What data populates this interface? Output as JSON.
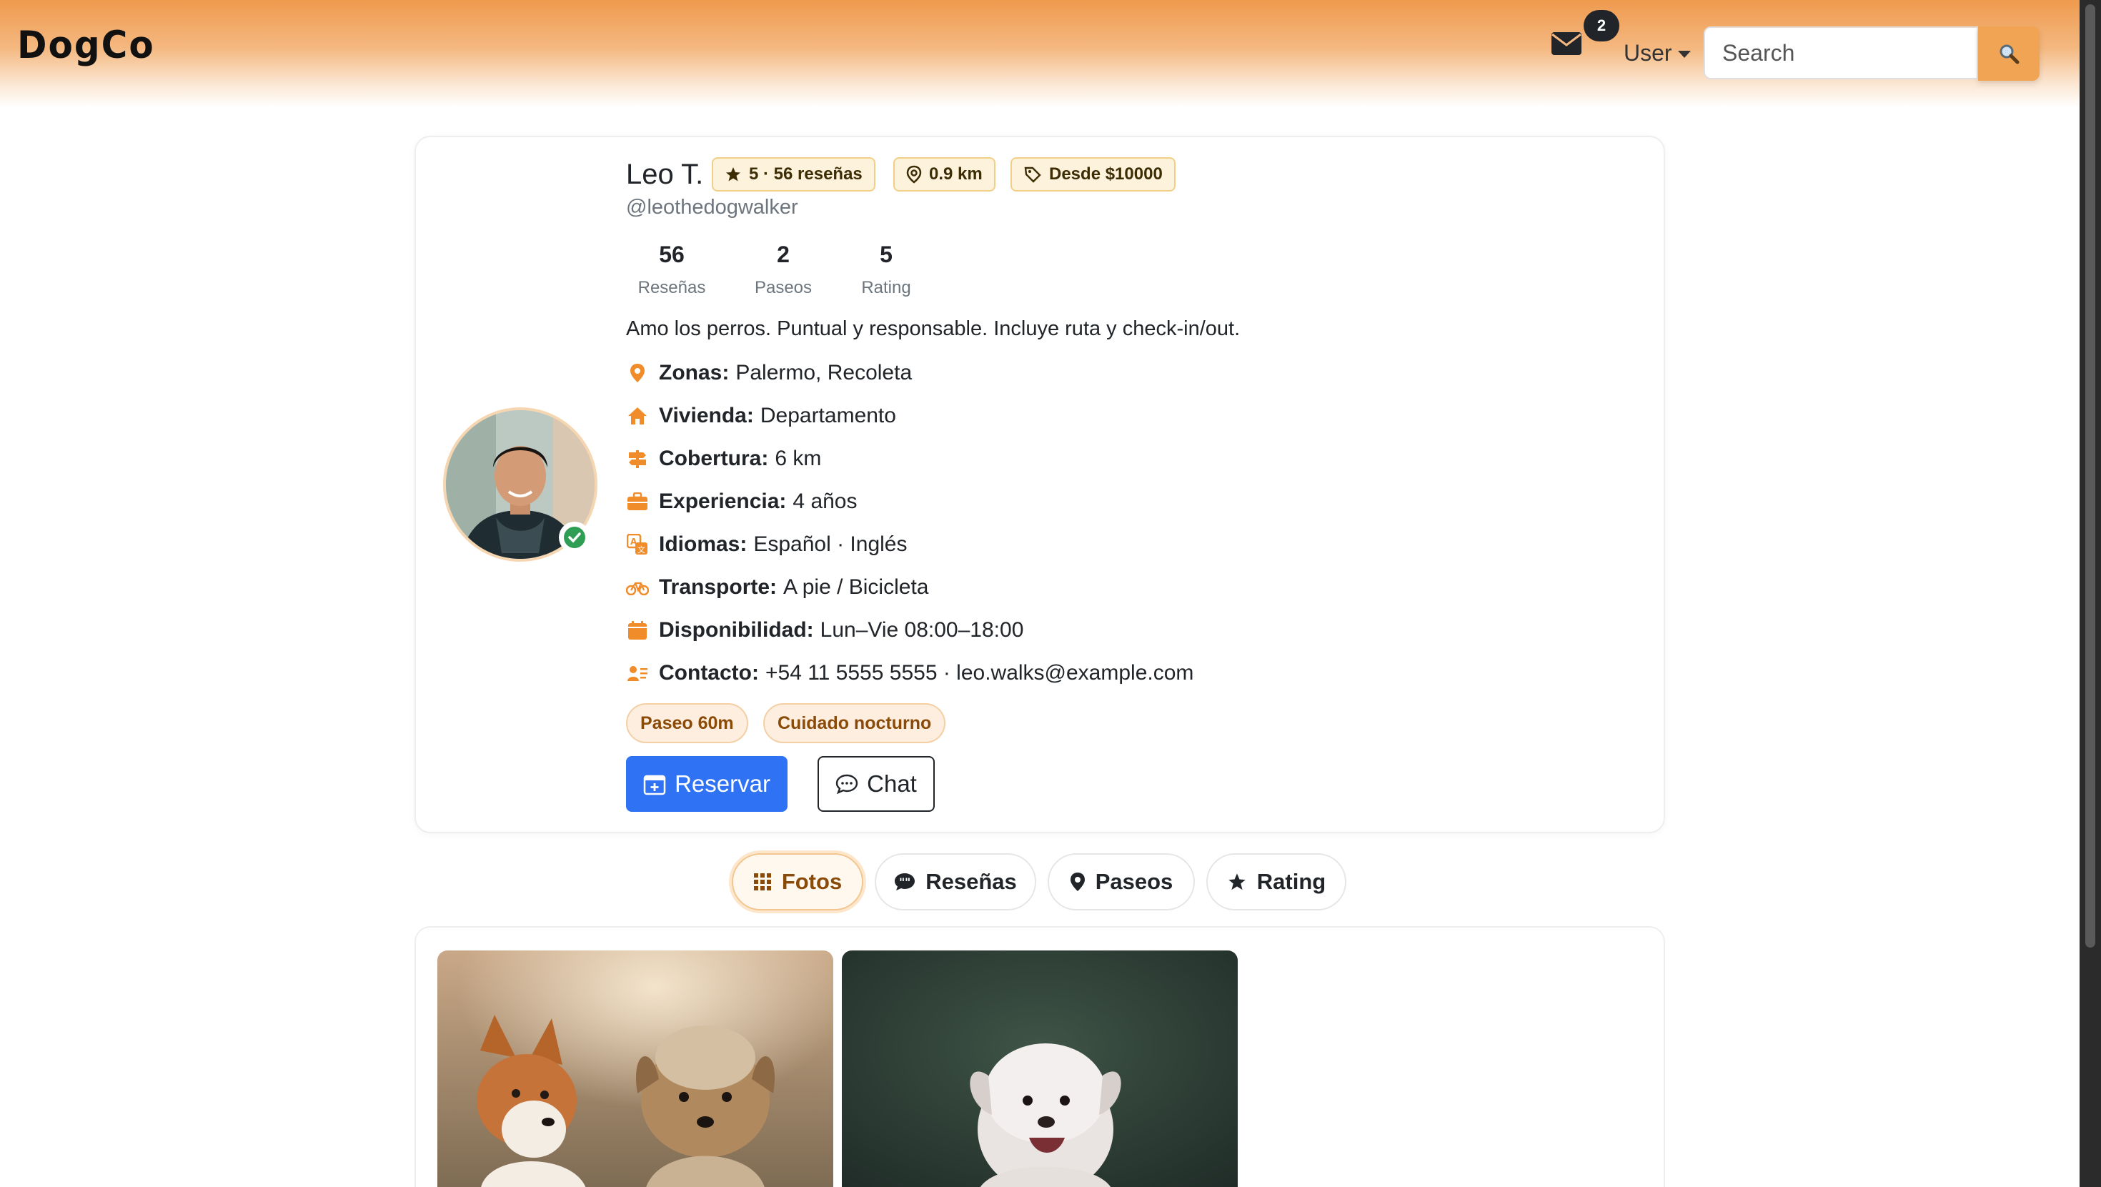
{
  "navbar": {
    "brand": "DogCo",
    "messages_badge": "2",
    "user_label": "User",
    "search_placeholder": "Search"
  },
  "profile": {
    "name": "Leo T.",
    "handle": "@leothedogwalker",
    "badges": {
      "rating": "5 · 56 reseñas",
      "distance": "0.9 km",
      "price": "Desde $10000"
    },
    "stats": [
      {
        "value": "56",
        "label": "Reseñas"
      },
      {
        "value": "2",
        "label": "Paseos"
      },
      {
        "value": "5",
        "label": "Rating"
      }
    ],
    "bio": "Amo los perros. Puntual y responsable. Incluye ruta y check-in/out.",
    "details": [
      {
        "label": "Zonas:",
        "value": "Palermo, Recoleta",
        "icon": "map-pin-icon"
      },
      {
        "label": "Vivienda:",
        "value": "Departamento",
        "icon": "house-icon"
      },
      {
        "label": "Cobertura:",
        "value": "6 km",
        "icon": "signpost-icon"
      },
      {
        "label": "Experiencia:",
        "value": "4 años",
        "icon": "briefcase-icon"
      },
      {
        "label": "Idiomas:",
        "value": "Español · Inglés",
        "icon": "translate-icon"
      },
      {
        "label": "Transporte:",
        "value": "A pie / Bicicleta",
        "icon": "bicycle-icon"
      },
      {
        "label": "Disponibilidad:",
        "value": "Lun–Vie 08:00–18:00",
        "icon": "calendar-icon"
      },
      {
        "label": "Contacto:",
        "value": "+54 11 5555 5555 · leo.walks@example.com",
        "icon": "contact-card-icon"
      }
    ],
    "services": [
      "Paseo 60m",
      "Cuidado nocturno"
    ],
    "actions": {
      "reserve": "Reservar",
      "chat": "Chat"
    }
  },
  "tabs": [
    {
      "label": "Fotos",
      "active": true
    },
    {
      "label": "Reseñas",
      "active": false
    },
    {
      "label": "Paseos",
      "active": false
    },
    {
      "label": "Rating",
      "active": false
    }
  ],
  "colors": {
    "accent": "#f2a455",
    "primary_button": "#2f73f4",
    "badge_bg": "#fdf3dc",
    "tag_text": "#8a4a08"
  }
}
